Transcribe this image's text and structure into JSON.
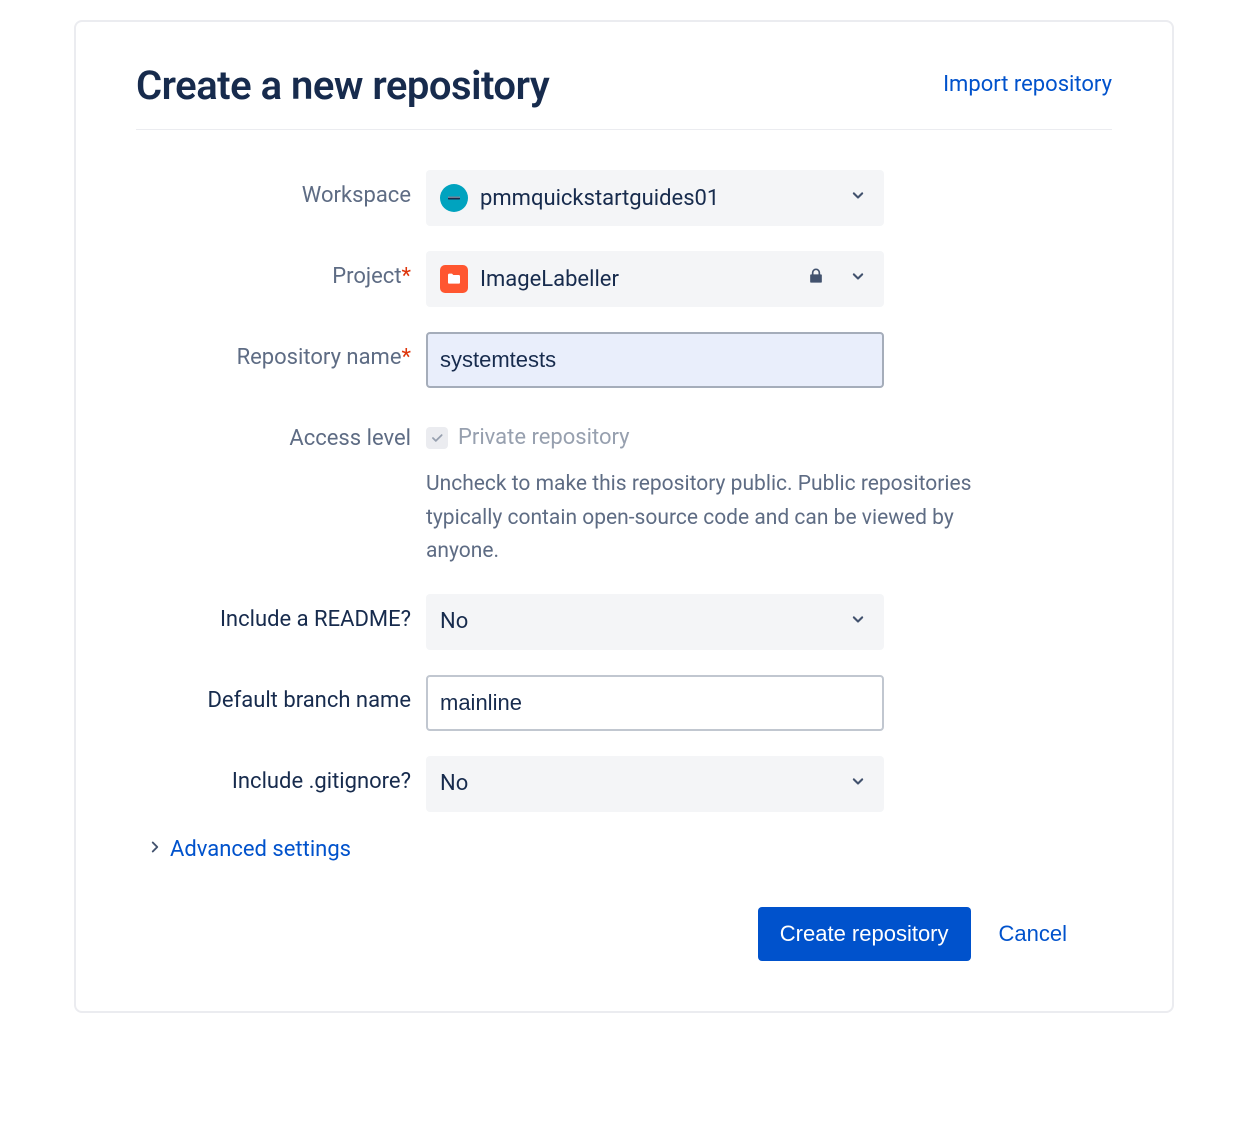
{
  "header": {
    "title": "Create a new repository",
    "import_link": "Import repository"
  },
  "labels": {
    "workspace": "Workspace",
    "project": "Project",
    "repo_name": "Repository name",
    "access_level": "Access level",
    "include_readme": "Include a README?",
    "default_branch": "Default branch name",
    "include_gitignore": "Include .gitignore?",
    "advanced": "Advanced settings"
  },
  "values": {
    "workspace": "pmmquickstartguides01",
    "project": "ImageLabeller",
    "repo_name": "systemtests",
    "access_checkbox_label": "Private repository",
    "access_help": "Uncheck to make this repository public. Public repositories typically contain open-source code and can be viewed by anyone.",
    "include_readme": "No",
    "default_branch": "mainline",
    "include_gitignore": "No"
  },
  "actions": {
    "create": "Create repository",
    "cancel": "Cancel"
  }
}
